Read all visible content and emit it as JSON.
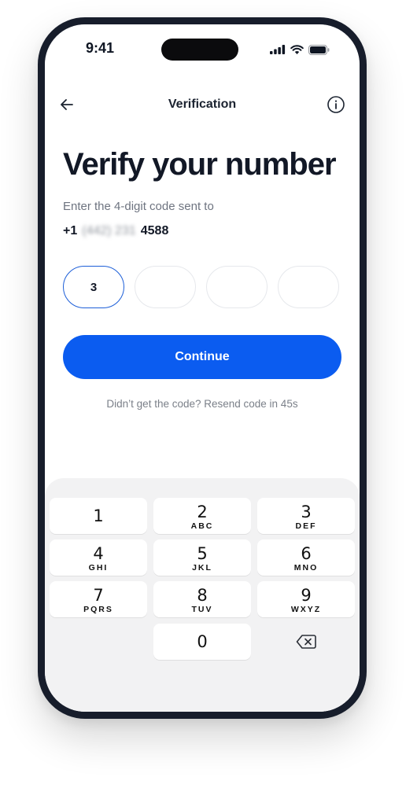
{
  "status_bar": {
    "time": "9:41"
  },
  "nav": {
    "title": "Verification",
    "back_icon": "arrow-left-icon",
    "info_icon": "info-icon"
  },
  "main": {
    "title": "Verify your number",
    "subtitle": "Enter the 4-digit code sent to",
    "phone_prefix": "+1",
    "phone_masked": "(442) 231",
    "phone_suffix": "4588",
    "code_digits": [
      "3",
      "",
      "",
      ""
    ],
    "continue_label": "Continue",
    "resend_text": "Didn’t get the code? Resend code in 45s"
  },
  "keypad": {
    "keys": [
      {
        "num": "1",
        "letters": ""
      },
      {
        "num": "2",
        "letters": "ABC"
      },
      {
        "num": "3",
        "letters": "DEF"
      },
      {
        "num": "4",
        "letters": "GHI"
      },
      {
        "num": "5",
        "letters": "JKL"
      },
      {
        "num": "6",
        "letters": "MNO"
      },
      {
        "num": "7",
        "letters": "PQRS"
      },
      {
        "num": "8",
        "letters": "TUV"
      },
      {
        "num": "9",
        "letters": "WXYZ"
      },
      {
        "num": "0",
        "letters": ""
      }
    ],
    "backspace_icon": "backspace-icon"
  },
  "colors": {
    "accent": "#0b5cf0",
    "frame": "#171d2b",
    "keypad_bg": "#f2f2f3"
  }
}
